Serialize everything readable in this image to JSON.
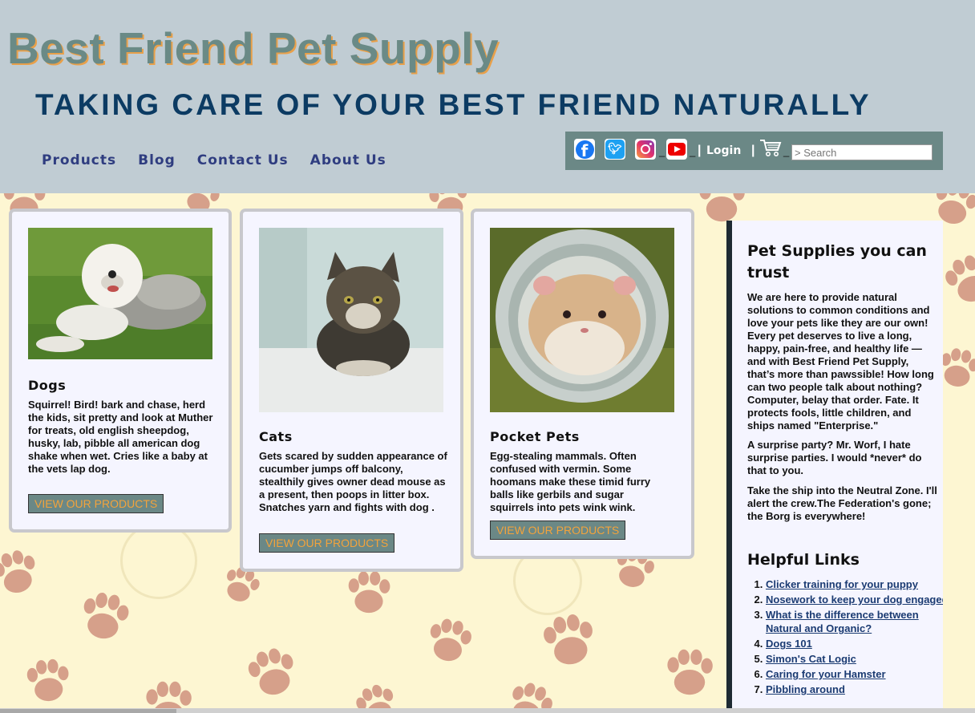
{
  "header": {
    "site_title": "Best Friend Pet Supply",
    "tagline": "TAKING CARE OF YOUR BEST FRIEND NATURALLY",
    "nav": [
      "Products",
      "Blog",
      "Contact Us",
      "About Us"
    ],
    "login_label": "Login",
    "search_placeholder": "> Search",
    "social_icons": [
      "facebook-icon",
      "twitter-icon",
      "instagram-icon",
      "youtube-icon"
    ],
    "cart_icon": "cart-icon"
  },
  "cards": [
    {
      "title": "Dogs",
      "image": "dog-photo",
      "text": "Squirrel! Bird! bark and chase, herd the kids, sit pretty and look at Muther for treats, old english sheepdog, husky, lab, pibble all american dog shake when wet. Cries like a baby at the vets lap dog.",
      "button": "VIEW OUR PRODUCTS"
    },
    {
      "title": "Cats",
      "image": "cat-photo",
      "text": "Gets scared by sudden appearance of cucumber jumps off balcony, stealthily gives owner dead mouse as a present, then poops in litter box. Snatches yarn and fights with dog .",
      "button": "VIEW OUR PRODUCTS"
    },
    {
      "title": "Pocket Pets",
      "image": "hamster-photo",
      "text": "Egg-stealing mammals. Often confused with vermin. Some hoomans make these timid furry balls like gerbils and sugar squirrels into pets wink wink.",
      "button": "VIEW OUR PRODUCTS"
    }
  ],
  "sidebar": {
    "heading": "Pet Supplies you can trust",
    "paragraphs": [
      "We are here to provide natural solutions to common conditions and love your pets like they are our own! Every pet deserves to live a long, happy, pain-free, and healthy life — and with Best Friend Pet Supply, that’s more than pawssible! How long can two people talk about nothing? Computer, belay that order. Fate. It protects fools, little children, and ships named \"Enterprise.\"",
      "A surprise party? Mr. Worf, I hate surprise parties. I would *never* do that to you.",
      "Take the ship into the Neutral Zone. I'll alert the crew.The Federation's gone; the Borg is everywhere!"
    ],
    "links_heading": "Helpful Links",
    "links": [
      "Clicker training for your puppy",
      "Nosework to keep your dog engaged",
      "What is the difference between Natural and Organic?",
      "Dogs 101",
      "Simon's Cat Logic",
      "Caring for your Hamster",
      "Pibbling around"
    ]
  },
  "colors": {
    "header_bg": "#c0ccd3",
    "title": "#6a8a86",
    "tagline": "#0c3b63",
    "nav": "#2f3d80",
    "toolbar_bg": "#6b8886",
    "button_text": "#f2a33c",
    "page_bg": "#fdf6d2",
    "paw": "#d8a088"
  }
}
